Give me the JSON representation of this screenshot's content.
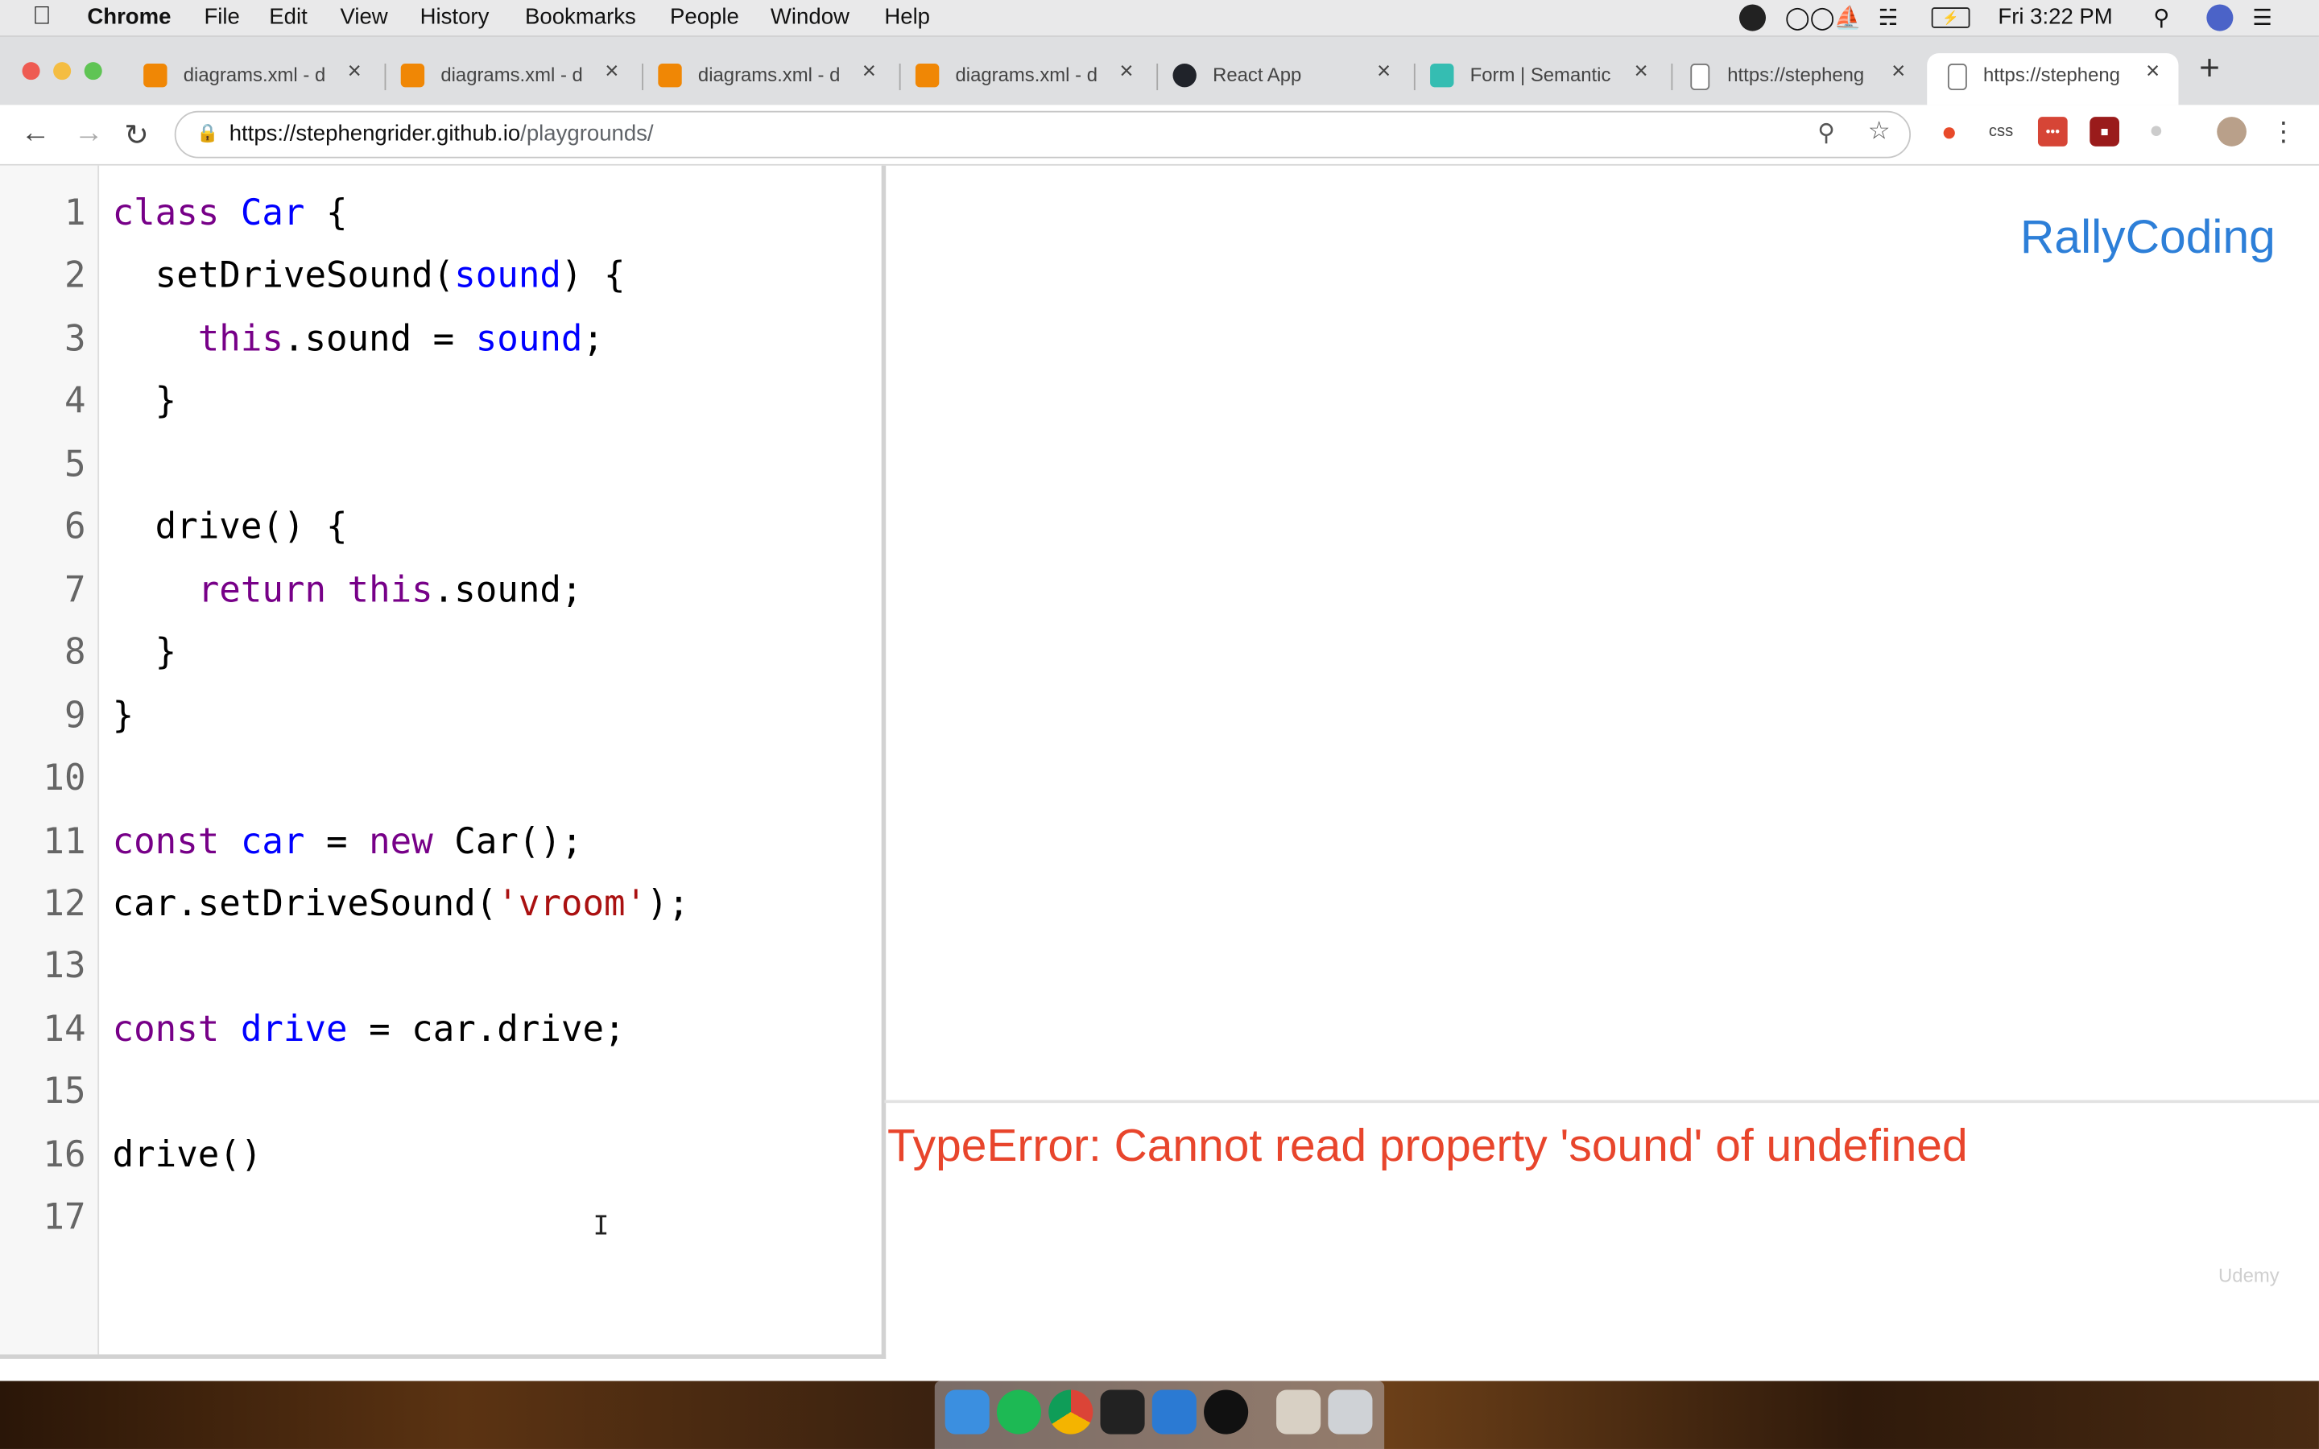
{
  "menubar": {
    "app_name": "Chrome",
    "items": [
      "File",
      "Edit",
      "View",
      "History",
      "Bookmarks",
      "People",
      "Window",
      "Help"
    ],
    "clock": "Fri 3:22 PM"
  },
  "tabs": [
    {
      "label": "diagrams.xml - d"
    },
    {
      "label": "diagrams.xml - d"
    },
    {
      "label": "diagrams.xml - d"
    },
    {
      "label": "diagrams.xml - d"
    },
    {
      "label": "React App"
    },
    {
      "label": "Form | Semantic"
    },
    {
      "label": "https://stepheng"
    },
    {
      "label": "https://stepheng"
    }
  ],
  "address": {
    "host": "https://stephengrider.github.io",
    "path": "/playgrounds/"
  },
  "extensions": {
    "css_label": "css"
  },
  "editor": {
    "line_numbers": [
      "1",
      "2",
      "3",
      "4",
      "5",
      "6",
      "7",
      "8",
      "9",
      "10",
      "11",
      "12",
      "13",
      "14",
      "15",
      "16",
      "17"
    ]
  },
  "output": {
    "brand": "RallyCoding",
    "error": "TypeError: Cannot read property 'sound' of undefined",
    "watermark": "Udemy"
  },
  "colors": {
    "keyword": "#770088",
    "variable": "#0000ff",
    "string": "#aa1111",
    "error": "#e8452c",
    "brand": "#2d7fd8"
  }
}
